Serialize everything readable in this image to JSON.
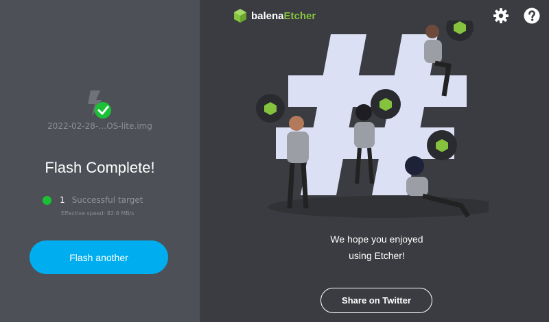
{
  "app": {
    "logo_part1": "balena",
    "logo_part2": "Etcher"
  },
  "left": {
    "filename": "2022-02-28-…OS-lite.img",
    "title": "Flash Complete!",
    "target_count": "1",
    "target_label": "Successful target",
    "speed": "Effective speed: 82.8 MB/s",
    "flash_another_label": "Flash another"
  },
  "right": {
    "message_line1": "We hope you enjoyed",
    "message_line2": "using Etcher!",
    "share_label": "Share on Twitter"
  },
  "icons": [
    "balena-cube-icon",
    "gear-icon",
    "help-icon",
    "flash-success-icon"
  ],
  "colors": {
    "left_bg": "#4d5057",
    "right_bg": "#3a3c41",
    "accent_blue": "#00aeef",
    "success_green": "#1ac135",
    "brand_green": "#85c33e"
  }
}
